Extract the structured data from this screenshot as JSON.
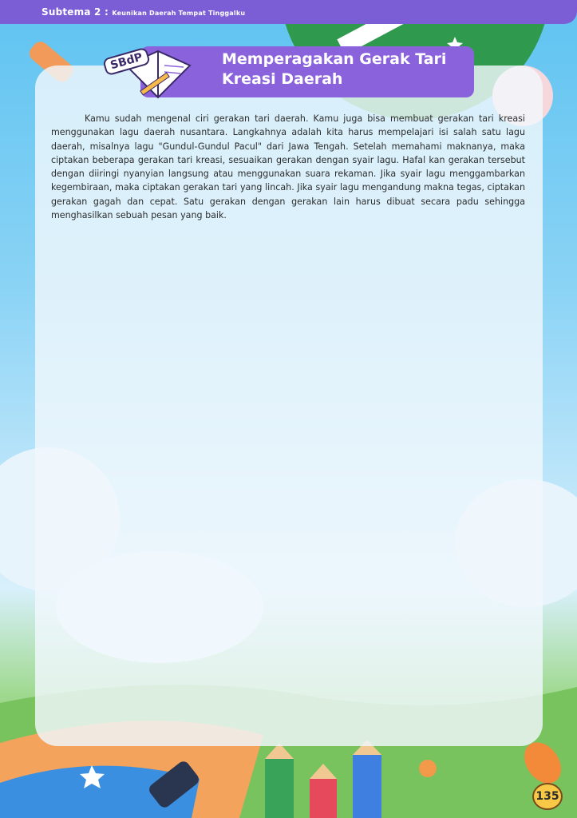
{
  "header": {
    "subtheme_label": "Subtema 2 :",
    "subtheme_title": "Keunikan Daerah Tempat Tinggalku"
  },
  "section": {
    "badge": "SBdP",
    "title_line1": "Memperagakan Gerak Tari",
    "title_line2": "Kreasi Daerah"
  },
  "content": {
    "paragraph": "Kamu sudah mengenal ciri gerakan tari daerah. Kamu juga bisa membuat gerakan tari kreasi menggunakan lagu daerah nusantara. Langkahnya adalah kita harus mempelajari isi salah satu lagu daerah, misalnya lagu \"Gundul-Gundul Pacul\" dari Jawa Tengah. Setelah memahami maknanya, maka ciptakan beberapa gerakan tari kreasi, sesuaikan gerakan dengan syair lagu. Hafal kan gerakan tersebut dengan diiringi nyanyian langsung atau menggunakan suara rekaman. Jika syair lagu menggambarkan kegembiraan, maka ciptakan gerakan tari yang lincah. Jika syair lagu mengandung makna tegas, ciptakan gerakan gagah dan cepat. Satu gerakan dengan gerakan lain harus dibuat secara padu sehingga menghasilkan sebuah pesan yang baik."
  },
  "footer": {
    "page_number": "135"
  },
  "colors": {
    "header_purple": "#7b5ed6",
    "banner_purple": "#8a63dc",
    "sky_blue": "#5fc3f1",
    "grass_green": "#64b85a",
    "page_badge_yellow": "#f7c947"
  },
  "icons": [
    "book-pencil-icon",
    "pencil-icon",
    "eraser-icon",
    "star-icon",
    "cloud-icon"
  ]
}
